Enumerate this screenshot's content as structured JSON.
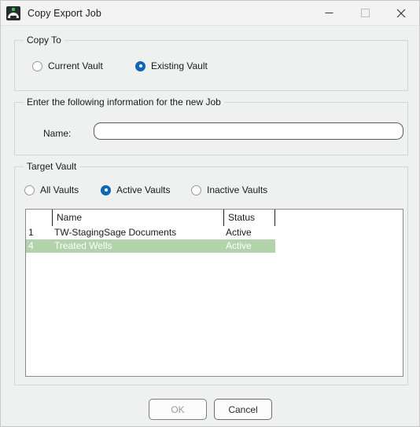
{
  "window": {
    "title": "Copy Export Job",
    "icon": "app-dome-icon",
    "controls": {
      "minimize": "minimize-icon",
      "maximize": "maximize-icon",
      "close": "close-icon"
    }
  },
  "copy_to": {
    "legend": "Copy To",
    "options": [
      {
        "label": "Current Vault",
        "checked": false
      },
      {
        "label": "Existing Vault",
        "checked": true
      }
    ]
  },
  "job_info": {
    "legend": "Enter the following information for the new Job",
    "name_label": "Name:",
    "name_value": "",
    "name_placeholder": ""
  },
  "target_vault": {
    "legend": "Target Vault",
    "filters": [
      {
        "label": "All Vaults",
        "checked": false
      },
      {
        "label": "Active Vaults",
        "checked": true
      },
      {
        "label": "Inactive Vaults",
        "checked": false
      }
    ],
    "grid": {
      "columns": [
        "",
        "Name",
        "Status",
        ""
      ],
      "rows": [
        {
          "num": "1",
          "name": "TW-StagingSage Documents",
          "status": "Active",
          "selected": false
        },
        {
          "num": "4",
          "name": "Treated Wells",
          "status": "Active",
          "selected": true
        }
      ]
    }
  },
  "footer": {
    "ok_label": "OK",
    "cancel_label": "Cancel"
  },
  "colors": {
    "accent": "#0f66ba",
    "selection": "#b2d3ab",
    "window_bg": "#eff0f0",
    "titlebar_bg": "#f3f3f3"
  }
}
